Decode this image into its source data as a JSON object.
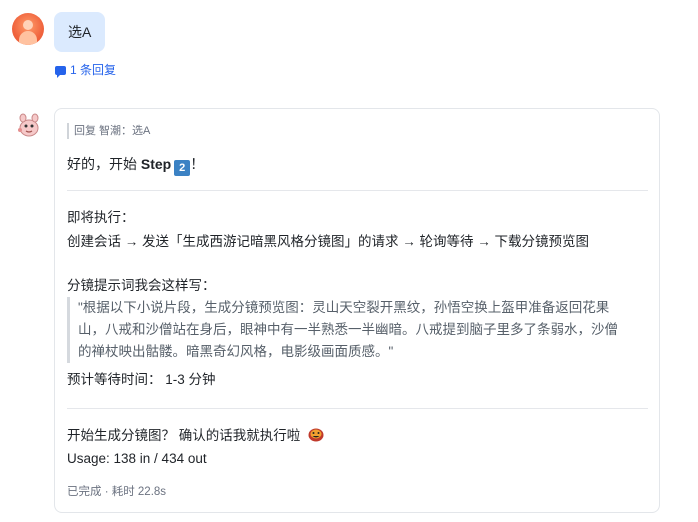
{
  "user_message": {
    "text": "选A",
    "reply_count": "1 条回复"
  },
  "bot_message": {
    "reply_quote": "回复 智潮：选A",
    "greeting_prefix": "好的，开始 ",
    "greeting_step": "Step",
    "step_number": "2",
    "greeting_suffix": "！",
    "about_to_execute_label": "即将执行：",
    "execution_flow": "创建会话 → 发送「生成西游记暗黑风格分镜图」的请求 → 轮询等待 → 下载分镜预览图",
    "prompt_intro": "分镜提示词我会这样写：",
    "prompt_lines": [
      "\"根据以下小说片段，生成分镜预览图：灵山天空裂开黑纹，孙悟空换上盔甲准备返回花果",
      "山，八戒和沙僧站在身后，眼神中有一半熟悉一半幽暗。八戒提到脑子里多了条弱水，沙僧",
      "的禅杖映出骷髅。暗黑奇幻风格，电影级画面质感。\""
    ],
    "wait_time": "预计等待时间：  1-3 分钟",
    "confirm_question": "开始生成分镜图？  确认的话我就执行啦",
    "usage": "Usage: 138 in / 434 out",
    "status": "已完成 · 耗时 22.8s"
  },
  "colors": {
    "user_bubble": "#dbeafe",
    "link_blue": "#2563eb",
    "step_badge": "#3b82c4"
  }
}
